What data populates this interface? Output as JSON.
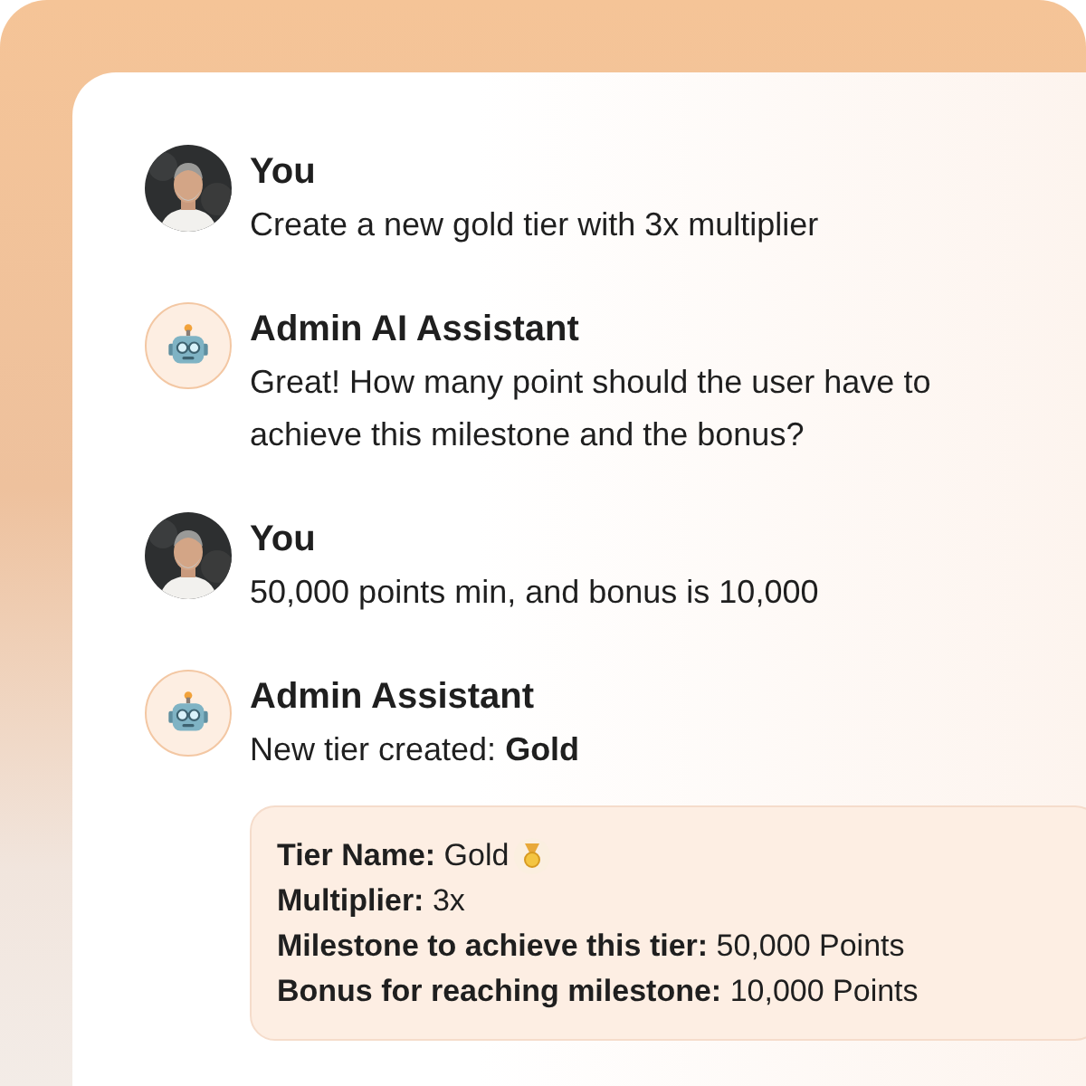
{
  "messages": [
    {
      "kind": "user",
      "name": "You",
      "text": "Create a new gold tier with 3x multiplier"
    },
    {
      "kind": "assistant",
      "name": "Admin AI Assistant",
      "text": "Great! How many point should the user have to achieve this milestone and the bonus?"
    },
    {
      "kind": "user",
      "name": "You",
      "text": "50,000 points min, and bonus is 10,000"
    },
    {
      "kind": "assistant",
      "name": "Admin Assistant",
      "text": "New tier created: **Gold**",
      "card": [
        {
          "label": "Tier Name:",
          "value": "Gold",
          "medal": true
        },
        {
          "label": "Multiplier:",
          "value": "3x",
          "medal": false
        },
        {
          "label": "Milestone to achieve this tier:",
          "value": "50,000 Points",
          "medal": false
        },
        {
          "label": "Bonus for reaching milestone:",
          "value": "10,000 Points",
          "medal": false
        }
      ]
    }
  ]
}
